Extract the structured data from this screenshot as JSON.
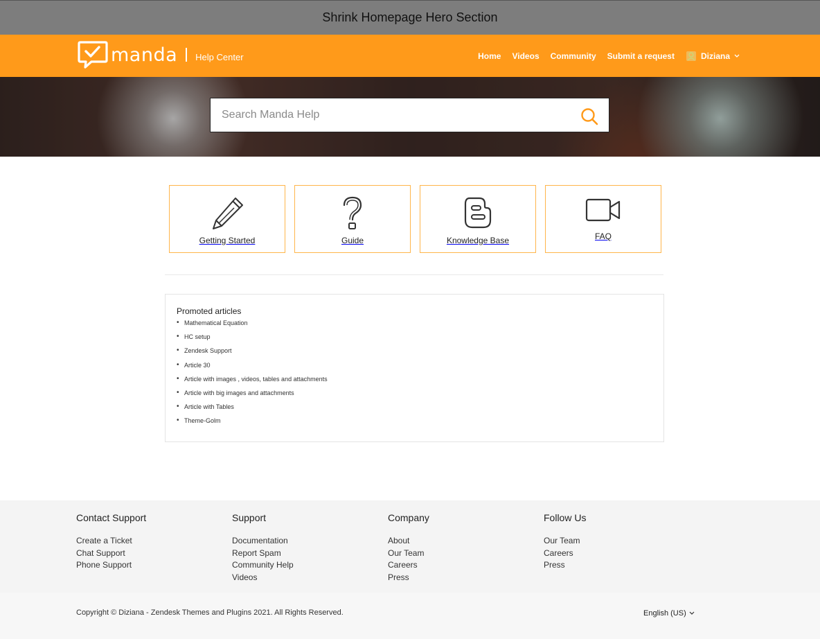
{
  "title_bar": {
    "text": "Shrink Homepage Hero Section"
  },
  "header": {
    "logo_text": "manda",
    "logo_sub": "Help Center",
    "nav": [
      {
        "label": "Home"
      },
      {
        "label": "Videos"
      },
      {
        "label": "Community"
      },
      {
        "label": "Submit a request"
      }
    ],
    "user": {
      "name": "Diziana",
      "icon": "user-avatar-icon"
    }
  },
  "search": {
    "placeholder": "Search Manda Help",
    "icon": "search-icon"
  },
  "categories": [
    {
      "label": "Getting Started",
      "icon": "pencil-icon"
    },
    {
      "label": "Guide",
      "icon": "question-mark-icon"
    },
    {
      "label": "Knowledge Base",
      "icon": "blogger-icon"
    },
    {
      "label": "FAQ",
      "icon": "video-camera-icon"
    }
  ],
  "promoted": {
    "title": "Promoted articles",
    "items": [
      "Mathematical Equation",
      "HC setup",
      "Zendesk Support",
      "Article 30",
      "Article with images , videos, tables and attachments",
      "Article with big images and attachments",
      "Article with Tables",
      "Theme-Golm"
    ]
  },
  "footer": {
    "columns": [
      {
        "title": "Contact Support",
        "links": [
          "Create a Ticket",
          "Chat Support",
          "Phone Support"
        ]
      },
      {
        "title": "Support",
        "links": [
          "Documentation",
          "Report Spam",
          "Community Help",
          "Videos"
        ]
      },
      {
        "title": "Company",
        "links": [
          "About",
          "Our Team",
          "Careers",
          "Press"
        ]
      },
      {
        "title": "Follow Us",
        "links": [
          "Our Team",
          "Careers",
          "Press"
        ]
      }
    ],
    "copyright": "Copyright © Diziana - Zendesk Themes and Plugins 2021. All Rights Reserved.",
    "language": "English (US)"
  },
  "colors": {
    "brand": "#ff9a1a",
    "card_border": "#ffb54a",
    "search_icon": "#ff9a1a"
  }
}
